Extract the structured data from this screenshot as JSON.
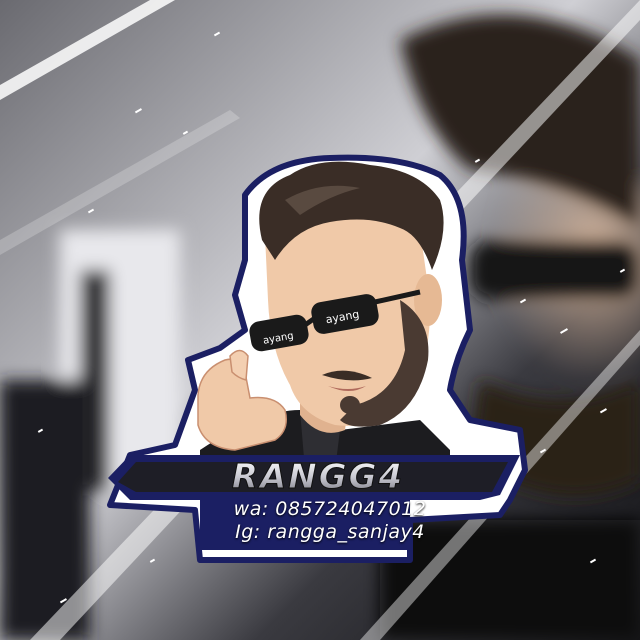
{
  "sticker": {
    "logo_text": "RANGG4",
    "whatsapp": "wa: 085724047012",
    "instagram": "Ig: rangga_sanjay4",
    "glasses_left_text": "ayang",
    "glasses_right_text": "ayang"
  },
  "colors": {
    "sticker_outline": "#1b1f63",
    "logo_fill": "#e8e8ee",
    "skin": "#f0c9a8",
    "hair": "#3a2d26",
    "glasses": "#1a1a1a",
    "banner": "#1b1f63"
  }
}
